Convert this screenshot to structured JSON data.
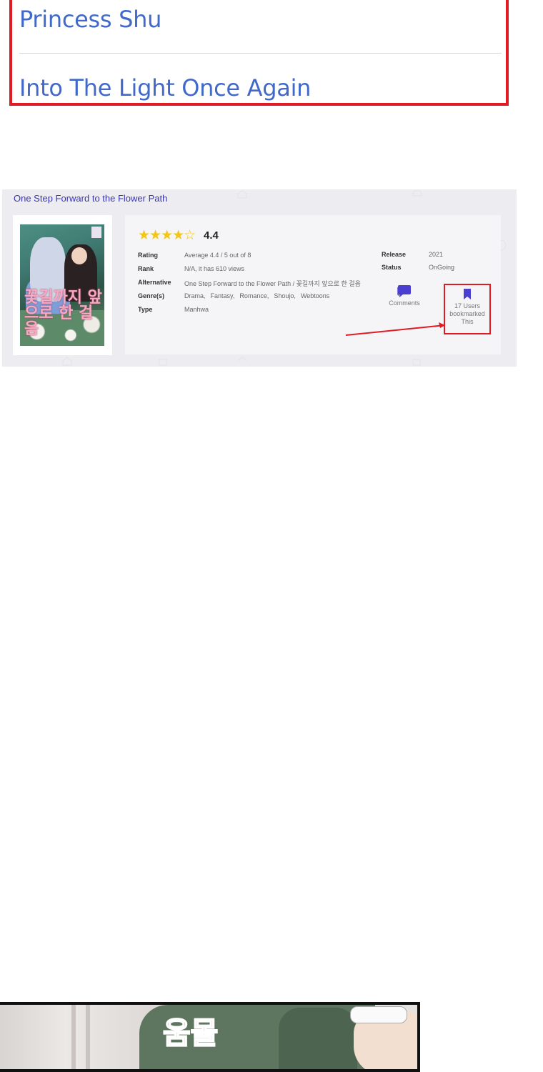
{
  "top_list": {
    "items": [
      "Princess Shu",
      "Into The Light Once Again"
    ]
  },
  "card": {
    "title": "One Step Forward to the Flower Path",
    "cover": {
      "title_text": "꽃길까지 앞으로 한 걸음",
      "badge": "TM"
    },
    "rating_stars": "★★★★☆",
    "rating_value": "4.4",
    "rating_fraction": 0.88,
    "rows": {
      "rating_label": "Rating",
      "rating_value": "Average 4.4 / 5 out of 8",
      "rank_label": "Rank",
      "rank_value": "N/A, it has 610 views",
      "alternative_label": "Alternative",
      "alternative_value": "One Step Forward to the Flower Path / 꽃길까지 앞으로 한 걸음",
      "genres_label": "Genre(s)",
      "genres": [
        "Drama,",
        "Fantasy,",
        "Romance,",
        "Shoujo,",
        "Webtoons"
      ],
      "type_label": "Type",
      "type_value": "Manhwa"
    },
    "side": {
      "release_label": "Release",
      "release_value": "2021",
      "status_label": "Status",
      "status_value": "OnGoing"
    },
    "comments_label": "Comments",
    "bookmark_label_1": "17 Users",
    "bookmark_label_2": "bookmarked",
    "bookmark_label_3": "This",
    "colors": {
      "accent": "#4b3fd1",
      "highlight": "#e01b24",
      "star": "#f3c614",
      "title": "#3a35b0"
    }
  },
  "comic": {
    "sfx": "움몰"
  },
  "icons": {
    "comments": "comments-icon",
    "bookmark": "bookmark-icon",
    "arrow": "arrow-annotation"
  }
}
